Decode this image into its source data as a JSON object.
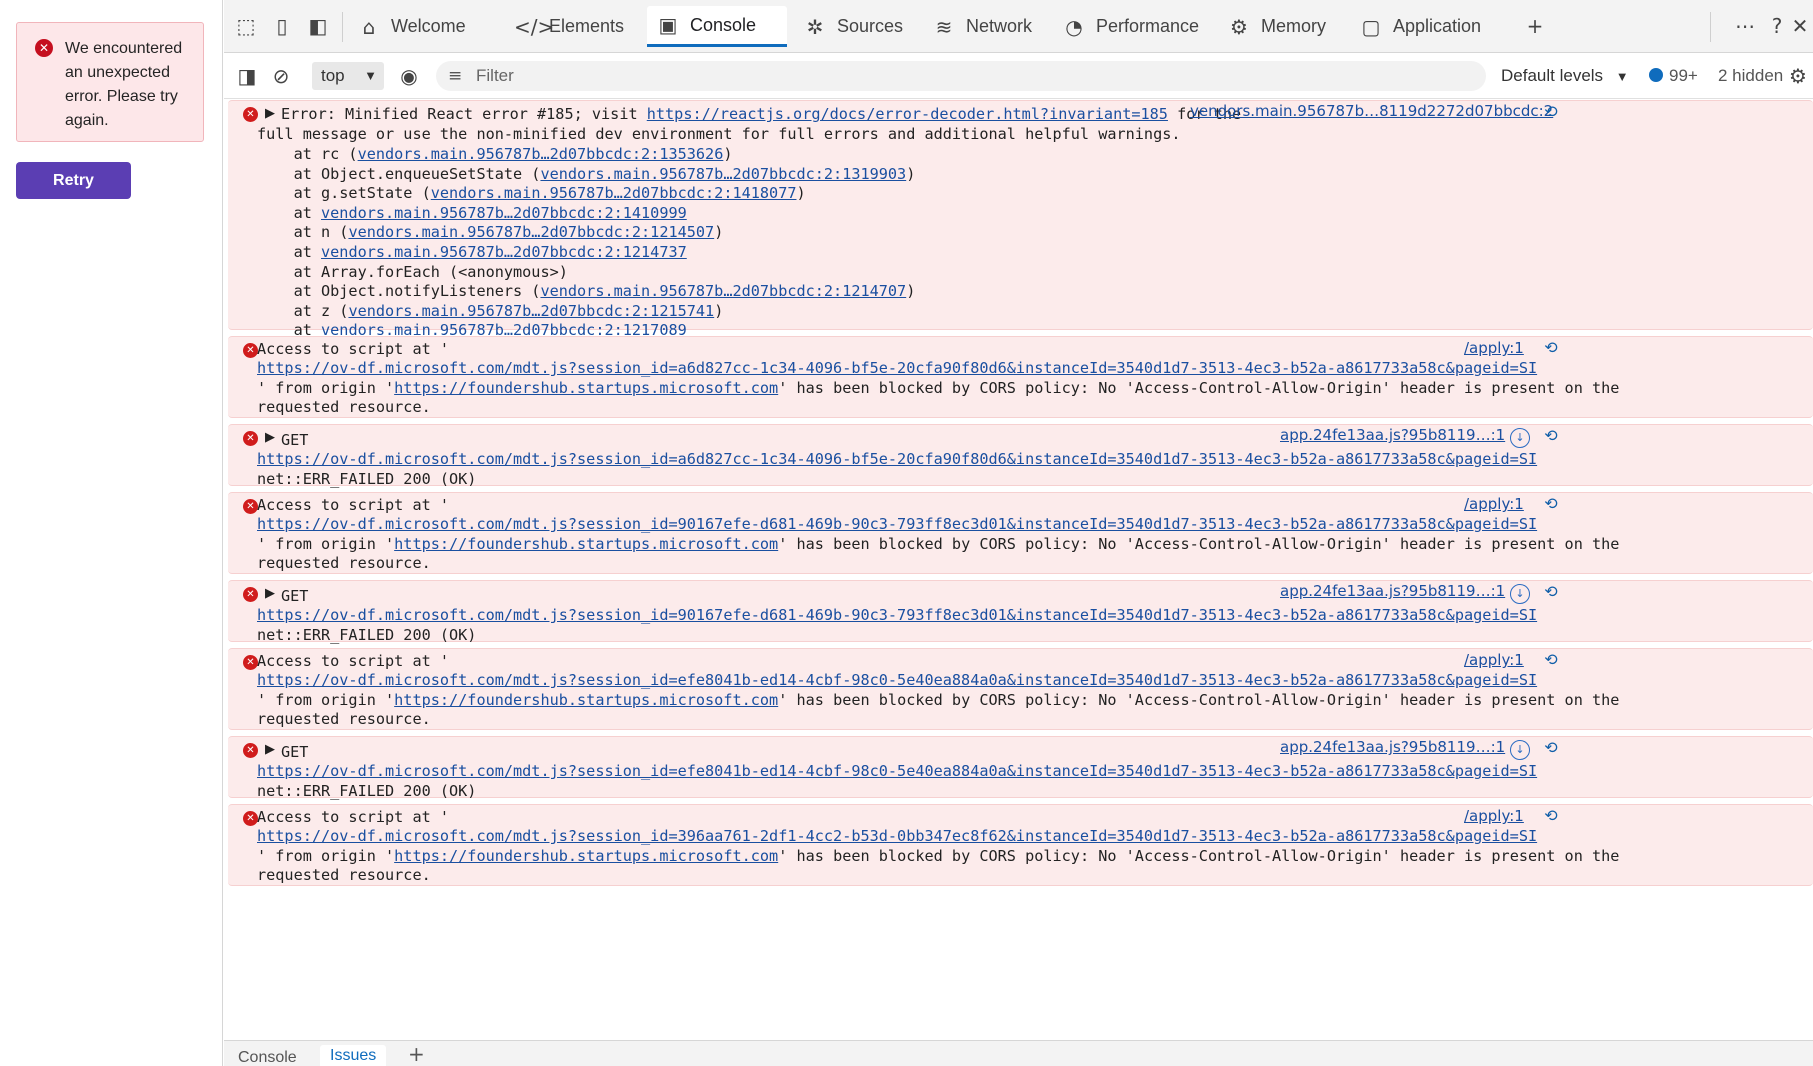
{
  "app": {
    "error_message": "We encountered an unexpected error. Please try again.",
    "retry_label": "Retry"
  },
  "devtools": {
    "tabs": [
      {
        "label": "Welcome",
        "icon": "home-icon"
      },
      {
        "label": "Elements",
        "icon": "code-icon"
      },
      {
        "label": "Console",
        "icon": "console-icon",
        "active": true
      },
      {
        "label": "Sources",
        "icon": "bug-icon"
      },
      {
        "label": "Network",
        "icon": "wifi-icon"
      },
      {
        "label": "Performance",
        "icon": "gauge-icon"
      },
      {
        "label": "Memory",
        "icon": "chip-icon"
      },
      {
        "label": "Application",
        "icon": "window-icon"
      }
    ],
    "toolbar": {
      "context": "top",
      "filter_placeholder": "Filter",
      "levels": "Default levels",
      "issues_count": "99+",
      "hidden": "2 hidden"
    },
    "drawer_tabs": [
      "Console",
      "Issues"
    ],
    "colors": {
      "accent": "#0f6cbd",
      "error_bg": "#fcebeb",
      "error_icon": "#d01c1c",
      "retry_bg": "#5b3eb3"
    }
  },
  "messages": {
    "m1": {
      "text_a": "Error: Minified React error #185; visit ",
      "link_a": "https://reactjs.org/docs/error-decoder.html?invariant=185",
      "text_b": " for the",
      "line2": "full message or use the non-minified dev environment for full errors and additional helpful warnings.",
      "source": "vendors.main.956787b…8119d2272d07bbcdc:2",
      "stack": [
        {
          "pre": "    at rc (",
          "link": "vendors.main.956787b…2d07bbcdc:2:1353626",
          "post": ")"
        },
        {
          "pre": "    at Object.enqueueSetState (",
          "link": "vendors.main.956787b…2d07bbcdc:2:1319903",
          "post": ")"
        },
        {
          "pre": "    at g.setState (",
          "link": "vendors.main.956787b…2d07bbcdc:2:1418077",
          "post": ")"
        },
        {
          "pre": "    at ",
          "link": "vendors.main.956787b…2d07bbcdc:2:1410999",
          "post": ""
        },
        {
          "pre": "    at n (",
          "link": "vendors.main.956787b…2d07bbcdc:2:1214507",
          "post": ")"
        },
        {
          "pre": "    at ",
          "link": "vendors.main.956787b…2d07bbcdc:2:1214737",
          "post": ""
        },
        {
          "pre": "    at Array.forEach (<anonymous>)",
          "link": "",
          "post": ""
        },
        {
          "pre": "    at Object.notifyListeners (",
          "link": "vendors.main.956787b…2d07bbcdc:2:1214707",
          "post": ")"
        },
        {
          "pre": "    at z (",
          "link": "vendors.main.956787b…2d07bbcdc:2:1215741",
          "post": ")"
        },
        {
          "pre": "    at ",
          "link": "vendors.main.956787b…2d07bbcdc:2:1217089",
          "post": ""
        }
      ]
    },
    "cors_prefix": "Access to script at '",
    "cors_mid_a": "' from origin '",
    "cors_origin": "https://foundershub.startups.microsoft.com",
    "cors_mid_b": "' has been blocked by CORS policy: No 'Access-Control-Allow-Origin' header is present on the",
    "cors_tail": "requested resource.",
    "cors_source": "/apply:1",
    "get_label": "GET",
    "get_status": "net::ERR_FAILED 200 (OK)",
    "get_source": "app.24fe13aa.js?95b8119…:1",
    "urls": {
      "u1": "https://ov-df.microsoft.com/mdt.js?session_id=a6d827cc-1c34-4096-bf5e-20cfa90f80d6&instanceId=3540d1d7-3513-4ec3-b52a-a8617733a58c&pageid=SI",
      "u2": "https://ov-df.microsoft.com/mdt.js?session_id=90167efe-d681-469b-90c3-793ff8ec3d01&instanceId=3540d1d7-3513-4ec3-b52a-a8617733a58c&pageid=SI",
      "u3": "https://ov-df.microsoft.com/mdt.js?session_id=efe8041b-ed14-4cbf-98c0-5e40ea884a0a&instanceId=3540d1d7-3513-4ec3-b52a-a8617733a58c&pageid=SI",
      "u4": "https://ov-df.microsoft.com/mdt.js?session_id=396aa761-2df1-4cc2-b53d-0bb347ec8f62&instanceId=3540d1d7-3513-4ec3-b52a-a8617733a58c&pageid=SI"
    }
  }
}
